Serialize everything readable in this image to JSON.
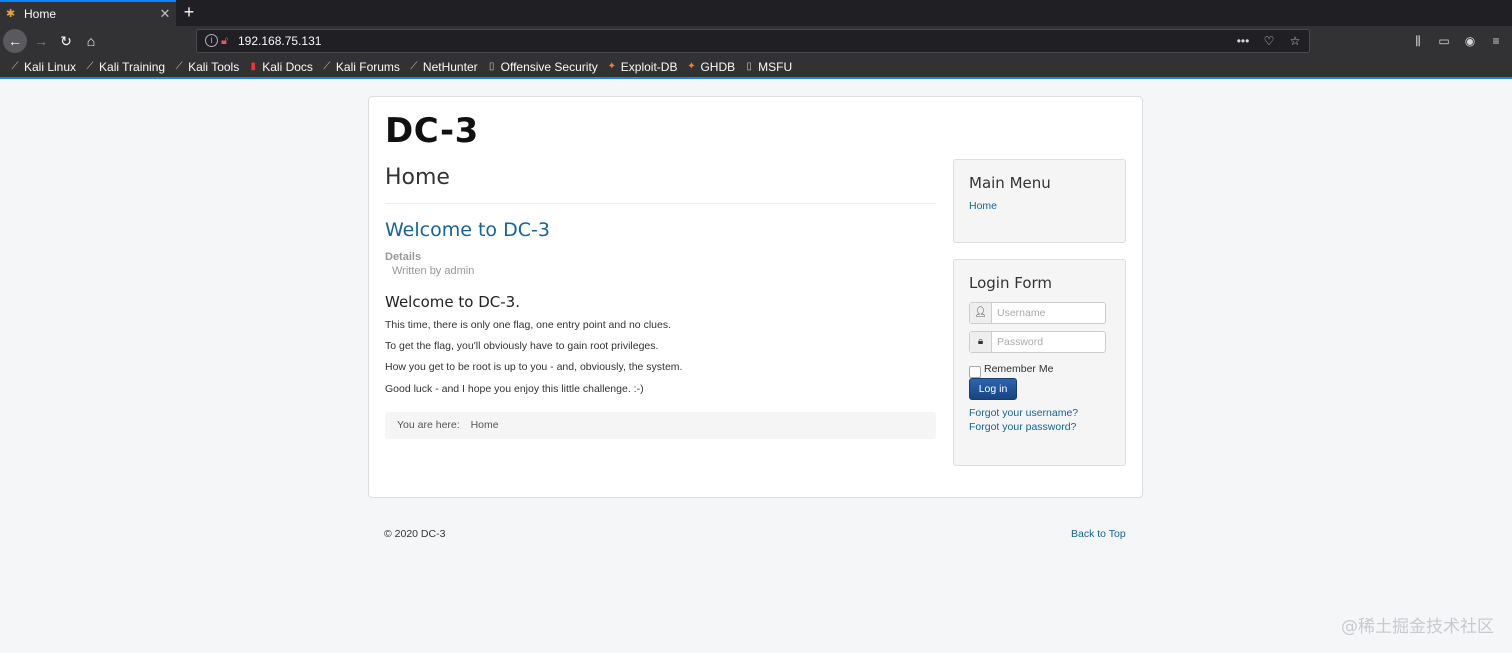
{
  "browser": {
    "tab": {
      "title": "Home",
      "icon": "joomla-icon",
      "close": "✕"
    },
    "new_tab": "+",
    "url": "192.168.75.131",
    "url_actions": [
      "•••",
      "pocket-icon",
      "star-icon"
    ],
    "toolbar_icons": [
      "library-icon",
      "sidebar-icon",
      "account-icon",
      "menu-icon"
    ],
    "bookmarks": [
      {
        "label": "Kali Linux",
        "icon": "kali-icon"
      },
      {
        "label": "Kali Training",
        "icon": "kali-icon"
      },
      {
        "label": "Kali Tools",
        "icon": "kali-icon"
      },
      {
        "label": "Kali Docs",
        "icon": "kali-docs-icon"
      },
      {
        "label": "Kali Forums",
        "icon": "kali-icon"
      },
      {
        "label": "NetHunter",
        "icon": "kali-icon"
      },
      {
        "label": "Offensive Security",
        "icon": "offsec-icon"
      },
      {
        "label": "Exploit-DB",
        "icon": "exploitdb-icon"
      },
      {
        "label": "GHDB",
        "icon": "ghdb-icon"
      },
      {
        "label": "MSFU",
        "icon": "offsec-icon"
      }
    ],
    "accent_color": "#1b8ad8"
  },
  "site": {
    "title": "DC-3",
    "page_heading": "Home",
    "article": {
      "title": "Welcome to DC-3",
      "details_label": "Details",
      "written_by": "Written by admin",
      "subtitle": "Welcome to DC-3.",
      "paragraphs": [
        "This time, there is only one flag, one entry point and no clues.",
        "To get the flag, you'll obviously have to gain root privileges.",
        "How you get to be root is up to you - and, obviously, the system.",
        "Good luck - and I hope you enjoy this little challenge.  :-)"
      ]
    },
    "breadcrumb": {
      "prefix": "You are here:",
      "current": "Home"
    },
    "main_menu": {
      "title": "Main Menu",
      "items": [
        "Home"
      ]
    },
    "login": {
      "title": "Login Form",
      "username_placeholder": "Username",
      "password_placeholder": "Password",
      "remember_label": "Remember Me",
      "button_label": "Log in",
      "forgot_username": "Forgot your username?",
      "forgot_password": "Forgot your password?"
    },
    "footer": {
      "copyright": "© 2020 DC-3",
      "back_to_top": "Back to Top"
    },
    "link_color": "#15649c",
    "button_color": "#1f4d8e"
  },
  "watermark": "@稀土掘金技术社区"
}
